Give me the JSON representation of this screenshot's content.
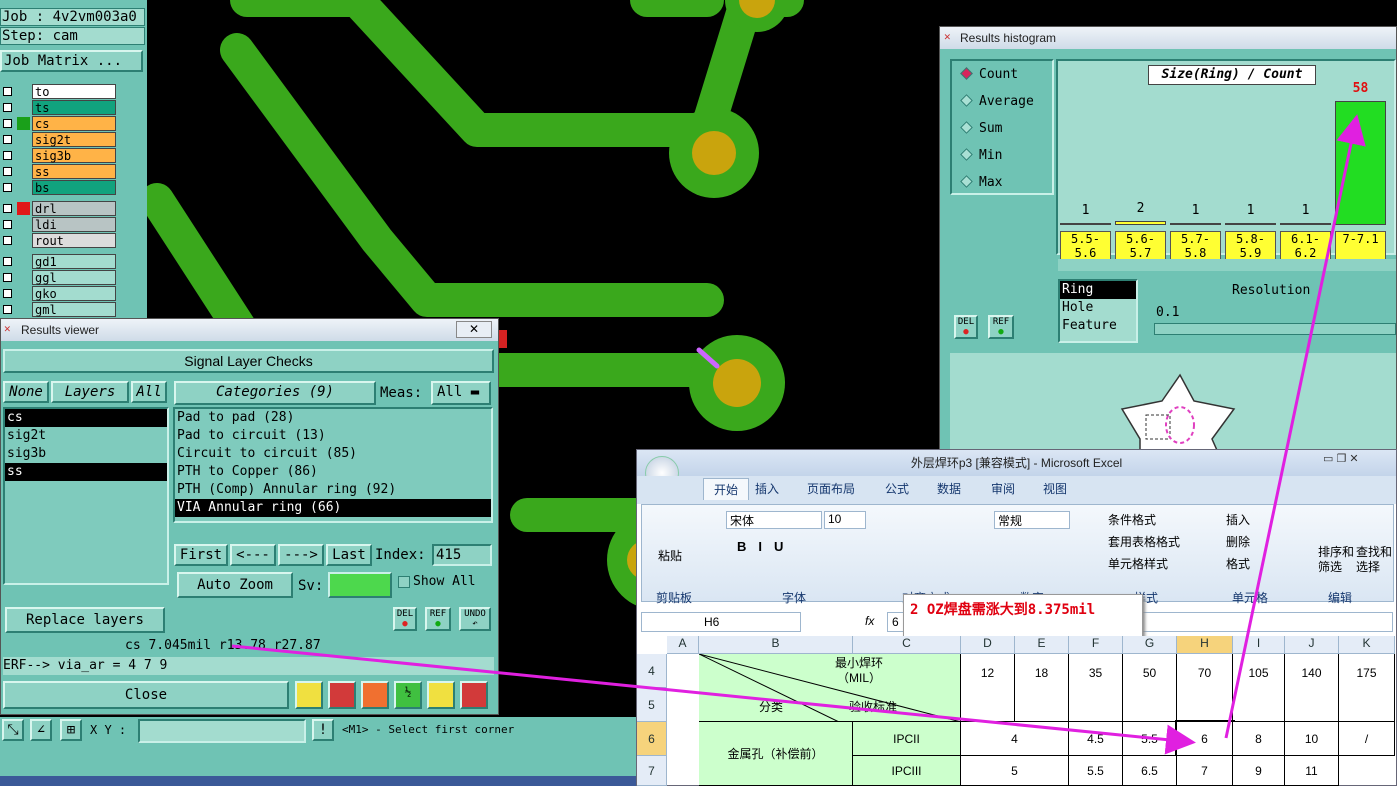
{
  "job": {
    "job_label": "Job : 4v2vm003a0",
    "step_label": "Step: cam",
    "matrix_button": "Job Matrix ..."
  },
  "layers": [
    {
      "name": "to",
      "color": "#ffffff"
    },
    {
      "name": "ts",
      "color": "#11a37e"
    },
    {
      "name": "cs",
      "color": "#ffb347"
    },
    {
      "name": "sig2t",
      "color": "#ffb347"
    },
    {
      "name": "sig3b",
      "color": "#ffb347"
    },
    {
      "name": "ss",
      "color": "#ffb347"
    },
    {
      "name": "bs",
      "color": "#11a37e"
    },
    {
      "name": "drl",
      "color": "#b8c4c4"
    },
    {
      "name": "ldi",
      "color": "#b8c4c4"
    },
    {
      "name": "rout",
      "color": "#dcdcdc"
    },
    {
      "name": "gd1",
      "color": "#a3dccf"
    },
    {
      "name": "ggl",
      "color": "#a3dccf"
    },
    {
      "name": "gko",
      "color": "#a3dccf"
    },
    {
      "name": "gml",
      "color": "#a3dccf"
    }
  ],
  "results_viewer": {
    "title": "Results viewer",
    "header": "Signal Layer Checks",
    "none_btn": "None",
    "layers_btn": "Layers",
    "all_btn": "All",
    "layer_list": [
      "cs",
      "sig2t",
      "sig3b",
      "ss"
    ],
    "categories_btn": "Categories (9)",
    "meas_label": "Meas:",
    "meas_value": "All",
    "categories": [
      "Pad to pad (28)",
      "Pad to circuit (13)",
      "Circuit to circuit (85)",
      "PTH to Copper (86)",
      "PTH (Comp) Annular ring (92)",
      "VIA Annular ring (66)"
    ],
    "first": "First",
    "prev": "<---",
    "next": "--->",
    "last": "Last",
    "index_label": "Index:",
    "index_value": "415",
    "auto_zoom": "Auto Zoom",
    "sv_label": "Sv:",
    "show_all": "Show All",
    "replace_layers": "Replace layers",
    "del": "DEL",
    "ref": "REF",
    "undo": "UNDO",
    "measure_text": "cs 7.045mil  r13.78  r27.87",
    "erf_text": "ERF--> via_ar = 4 7 9",
    "close": "Close"
  },
  "statusbar": {
    "xy_label": "X Y :",
    "prompt": "<M1> - Select first corner"
  },
  "histogram": {
    "title": "Results histogram",
    "modes": [
      "Count",
      "Average",
      "Sum",
      "Min",
      "Max"
    ],
    "selected_mode": "Count",
    "chart_title": "Size(Ring) / Count",
    "bins": [
      {
        "label": "5.5-5.6",
        "count": "1"
      },
      {
        "label": "5.6-5.7",
        "count": "2"
      },
      {
        "label": "5.7-5.8",
        "count": "1"
      },
      {
        "label": "5.8-5.9",
        "count": "1"
      },
      {
        "label": "6.1-6.2",
        "count": "1"
      },
      {
        "label": "7-7.1",
        "count": "58"
      }
    ],
    "size_types": [
      "Ring",
      "Hole",
      "Feature"
    ],
    "resolution_label": "Resolution",
    "resolution_value": "0.1",
    "del": "DEL",
    "ref": "REF"
  },
  "excel": {
    "title": "外层焊环p3  [兼容模式] - Microsoft Excel",
    "tabs": [
      "开始",
      "插入",
      "页面布局",
      "公式",
      "数据",
      "审阅",
      "视图"
    ],
    "font_name": "宋体",
    "font_size": "10",
    "number_format": "常规",
    "paste": "粘贴",
    "cond_format": "条件格式",
    "table_format": "套用表格格式",
    "cell_style": "单元格样式",
    "insert": "插入",
    "delete": "删除",
    "format": "格式",
    "sort_filter": "排序和\n筛选",
    "find_select": "查找和\n选择",
    "groups": {
      "clipboard": "剪贴板",
      "font": "字体",
      "align": "对齐方式",
      "number": "数字",
      "style": "样式",
      "cells": "单元格",
      "edit": "编辑"
    },
    "name_box": "H6",
    "formula_value": "6",
    "callout": "2 OZ焊盘需涨大到8.375mil",
    "columns": [
      "A",
      "B",
      "C",
      "D",
      "E",
      "F",
      "G",
      "H",
      "I",
      "J",
      "K"
    ],
    "rows": [
      "4",
      "5",
      "6",
      "7"
    ],
    "header_text1": "最小焊环\n（MIL）",
    "header_text2": "分类",
    "header_text3": "验收标准",
    "header_values": [
      "12",
      "18",
      "35",
      "50",
      "70",
      "105",
      "140",
      "175"
    ],
    "row_label": "金属孔（补偿前）",
    "ipc2": "IPCII",
    "ipc3": "IPCIII",
    "ipc2_values": [
      "4",
      "4.5",
      "5.5",
      "6",
      "8",
      "10",
      "/"
    ],
    "ipc3_values": [
      "5",
      "5.5",
      "6.5",
      "7",
      "9",
      "11"
    ]
  }
}
